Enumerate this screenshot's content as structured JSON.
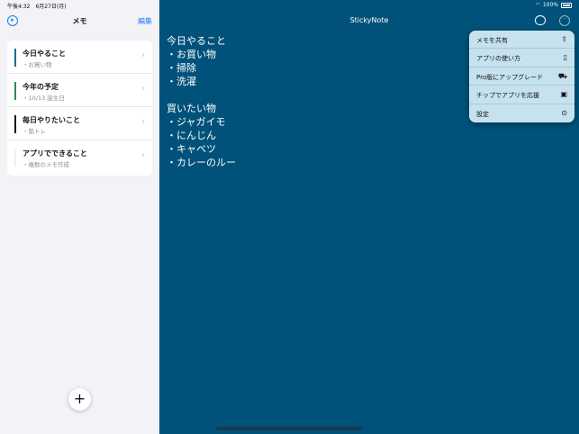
{
  "status": {
    "time_date": "午後4:32　6月27日(月)",
    "battery": "100%"
  },
  "sidebar": {
    "title": "メモ",
    "edit_label": "編集",
    "memos": [
      {
        "title": "今日やること",
        "subtitle": "・お買い物",
        "color": "#1e6b8c"
      },
      {
        "title": "今年の予定",
        "subtitle": "・10/13 誕生日",
        "color": "#2e8b57"
      },
      {
        "title": "毎日やりたいこと",
        "subtitle": "・筋トレ",
        "color": "#111111"
      },
      {
        "title": "アプリでできること",
        "subtitle": "・複数のメモ作成",
        "color": "#ffffff"
      }
    ],
    "add_label": "+"
  },
  "main": {
    "title": "StickyNote",
    "background": "#00527a",
    "body": "今日やること\n・お買い物\n・掃除\n・洗濯\n\n買いたい物\n・ジャガイモ\n・にんじん\n・キャベツ\n・カレーのルー"
  },
  "menu": {
    "items": [
      {
        "label": "メモを共有",
        "icon": "share-icon"
      },
      {
        "label": "アプリの使い方",
        "icon": "phone-icon"
      },
      {
        "label": "Pro版にアップグレード",
        "icon": "cart-icon"
      },
      {
        "label": "チップでアプリを応援",
        "icon": "gift-icon"
      },
      {
        "label": "設定",
        "icon": "settings-icon"
      }
    ]
  }
}
